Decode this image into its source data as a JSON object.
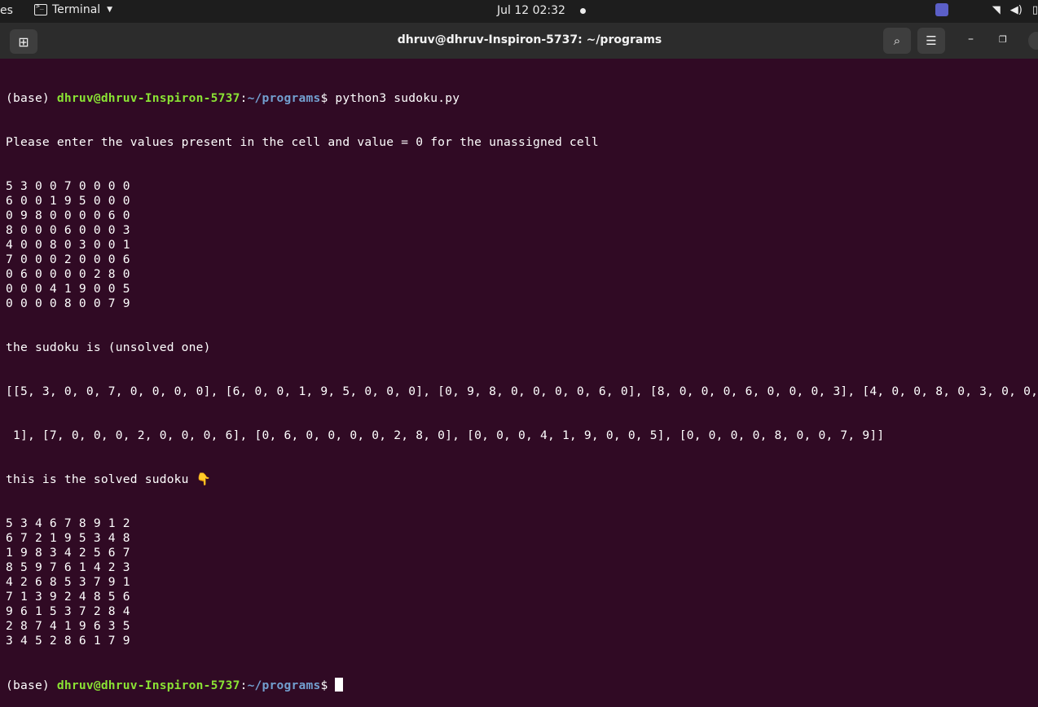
{
  "top_bar": {
    "activities": "es",
    "app_name": "Terminal",
    "clock": "Jul 12  02:32",
    "icons": [
      "teams-icon",
      "wifi-icon",
      "volume-icon",
      "battery-icon"
    ]
  },
  "window": {
    "title": "dhruv@dhruv-Inspiron-5737: ~/programs"
  },
  "prompt": {
    "env": "(base) ",
    "user_host": "dhruv@dhruv-Inspiron-5737",
    "colon": ":",
    "path": "~/programs",
    "symbol": "$ "
  },
  "terminal": {
    "command": "python3 sudoku.py",
    "message": "Please enter the values present in the cell and value = 0 for the unassigned cell",
    "input_rows": [
      "5 3 0 0 7 0 0 0 0",
      "6 0 0 1 9 5 0 0 0",
      "0 9 8 0 0 0 0 6 0",
      "8 0 0 0 6 0 0 0 3",
      "4 0 0 8 0 3 0 0 1",
      "7 0 0 0 2 0 0 0 6",
      "0 6 0 0 0 0 2 8 0",
      "0 0 0 4 1 9 0 0 5",
      "0 0 0 0 8 0 0 7 9"
    ],
    "unsolved_label": "the sudoku is (unsolved one)",
    "list_line_1": "[[5, 3, 0, 0, 7, 0, 0, 0, 0], [6, 0, 0, 1, 9, 5, 0, 0, 0], [0, 9, 8, 0, 0, 0, 0, 6, 0], [8, 0, 0, 0, 6, 0, 0, 0, 3], [4, 0, 0, 8, 0, 3, 0, 0,",
    "list_line_2": " 1], [7, 0, 0, 0, 2, 0, 0, 0, 6], [0, 6, 0, 0, 0, 0, 2, 8, 0], [0, 0, 0, 4, 1, 9, 0, 0, 5], [0, 0, 0, 0, 8, 0, 0, 7, 9]]",
    "solved_label": "this is the solved sudoku 👇",
    "solved_rows": [
      "5 3 4 6 7 8 9 1 2",
      "6 7 2 1 9 5 3 4 8",
      "1 9 8 3 4 2 5 6 7",
      "8 5 9 7 6 1 4 2 3",
      "4 2 6 8 5 3 7 9 1",
      "7 1 3 9 2 4 8 5 6",
      "9 6 1 5 3 7 2 8 4",
      "2 8 7 4 1 9 6 3 5",
      "3 4 5 2 8 6 1 7 9"
    ]
  }
}
